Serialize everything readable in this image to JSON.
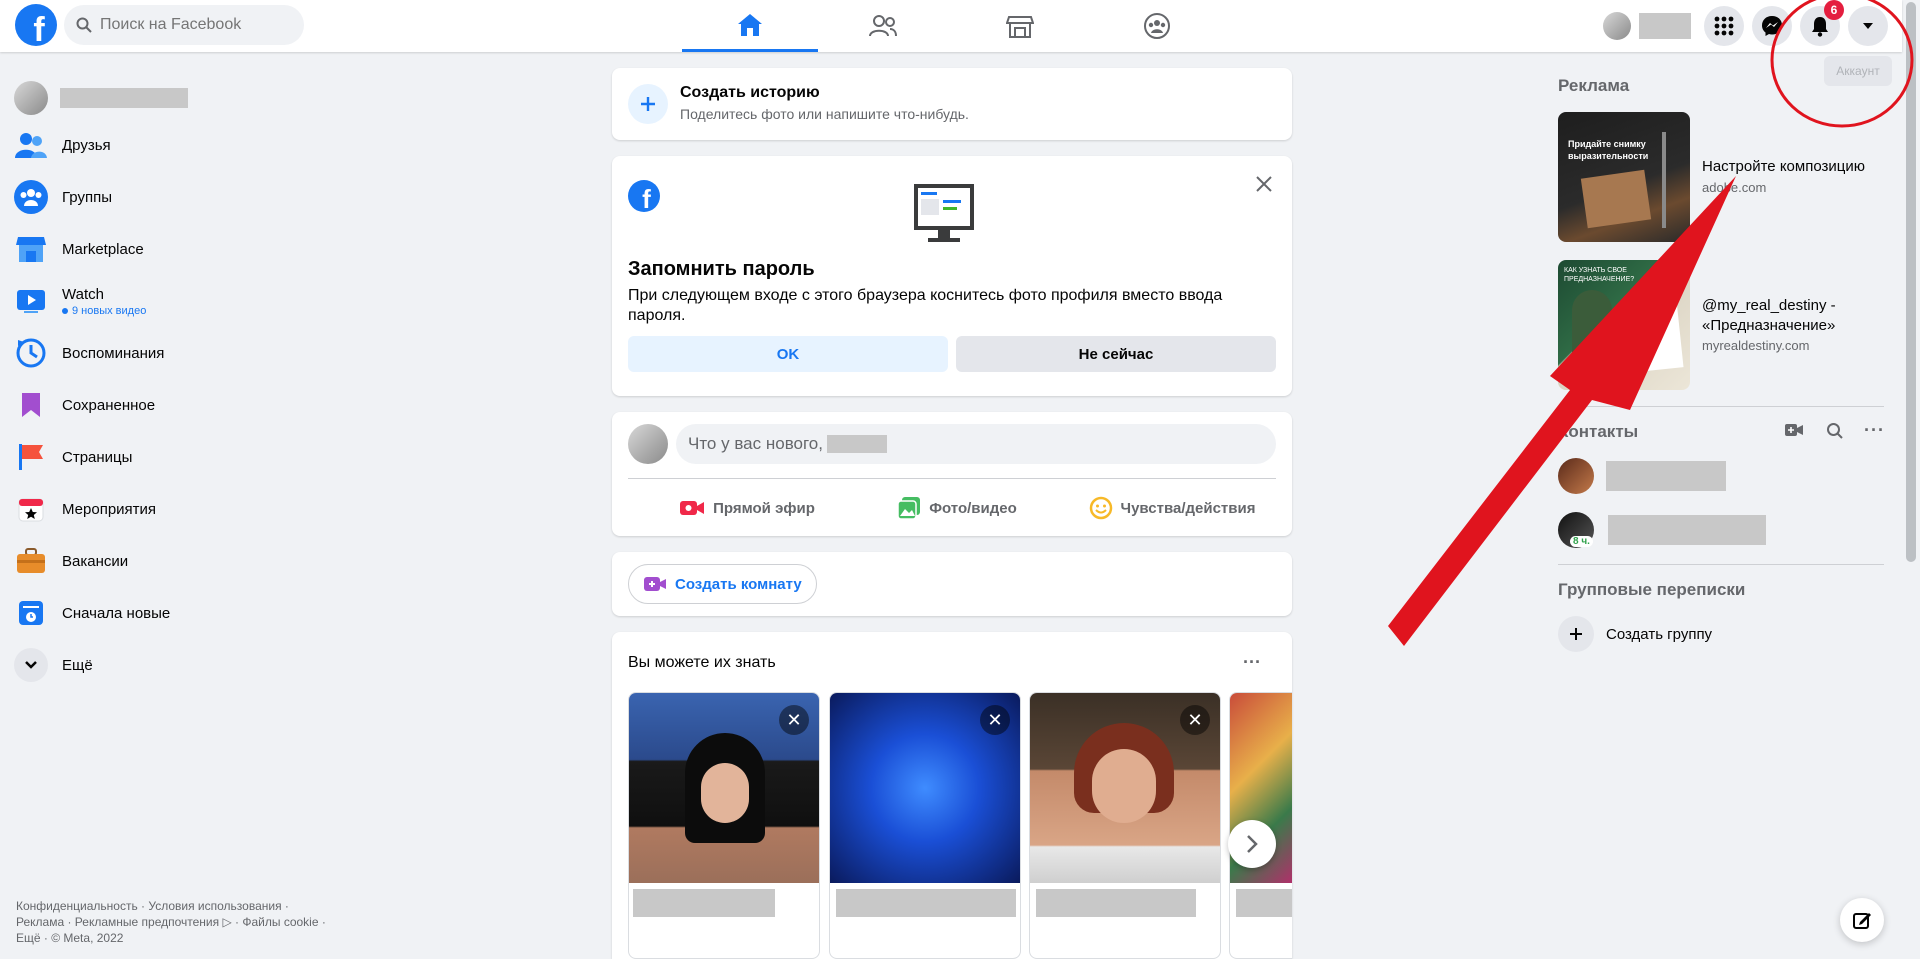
{
  "header": {
    "logo": "f",
    "search_placeholder": "Поиск на Facebook",
    "nav_tabs": [
      "home",
      "friends",
      "marketplace",
      "groups"
    ],
    "notifications_badge": "6",
    "account_tooltip": "Аккаунт"
  },
  "sidebar": {
    "items": [
      {
        "label": "Друзья",
        "icon": "friends-icon"
      },
      {
        "label": "Группы",
        "icon": "groups-icon"
      },
      {
        "label": "Marketplace",
        "icon": "marketplace-icon"
      },
      {
        "label": "Watch",
        "sub": "9 новых видео",
        "icon": "watch-icon"
      },
      {
        "label": "Воспоминания",
        "icon": "memories-icon"
      },
      {
        "label": "Сохраненное",
        "icon": "saved-icon"
      },
      {
        "label": "Страницы",
        "icon": "pages-icon"
      },
      {
        "label": "Мероприятия",
        "icon": "events-icon"
      },
      {
        "label": "Вакансии",
        "icon": "jobs-icon"
      },
      {
        "label": "Сначала новые",
        "icon": "most-recent-icon"
      },
      {
        "label": "Ещё",
        "icon": "chevron-down-icon"
      }
    ],
    "footer": [
      "Конфиденциальность · Условия использования ·",
      "Реклама · Рекламные предпочтения ▷ · Файлы cookie ·",
      "Ещё · © Meta, 2022"
    ]
  },
  "feed": {
    "story": {
      "title": "Создать историю",
      "subtitle": "Поделитесь фото или напишите что-нибудь."
    },
    "password": {
      "title": "Запомнить пароль",
      "text": "При следующем входе с этого браузера коснитесь фото профиля вместо ввода пароля.",
      "ok": "OK",
      "not_now": "Не сейчас"
    },
    "composer": {
      "placeholder": "Что у вас нового,",
      "live": "Прямой эфир",
      "photo": "Фото/видео",
      "feeling": "Чувства/действия"
    },
    "room": "Создать комнату",
    "pymk": {
      "title": "Вы можете их знать",
      "more": "···"
    }
  },
  "right": {
    "ads_title": "Реклама",
    "ads": [
      {
        "title": "Настройте композицию",
        "domain": "adobe.com",
        "art_text": "Придайте снимку выразительности"
      },
      {
        "title": "@my_real_destiny - «Предназначение»",
        "domain": "myrealdestiny.com",
        "art_text": "КАК УЗНАТЬ СВОЕ ПРЕДНАЗНАЧЕНИЕ?"
      }
    ],
    "contacts_title": "Контакты",
    "contact_time": "8 ч.",
    "group_chats_title": "Групповые переписки",
    "create_group": "Создать группу"
  },
  "colors": {
    "brand": "#1877f2",
    "annotation": "#e0141e"
  }
}
